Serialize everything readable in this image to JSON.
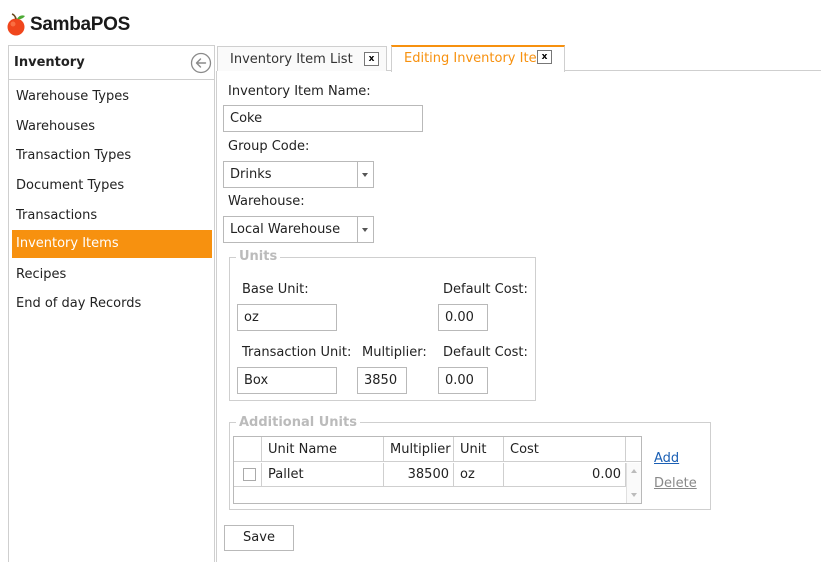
{
  "app": {
    "logo_text": "SambaPOS"
  },
  "sidebar": {
    "title": "Inventory",
    "items": [
      {
        "label": "Warehouse Types",
        "active": false
      },
      {
        "label": "Warehouses",
        "active": false
      },
      {
        "label": "Transaction Types",
        "active": false
      },
      {
        "label": "Document Types",
        "active": false
      },
      {
        "label": "Transactions",
        "active": false
      },
      {
        "label": "Inventory Items",
        "active": true
      },
      {
        "label": "Recipes",
        "active": false
      },
      {
        "label": "End of day Records",
        "active": false
      }
    ]
  },
  "tabs": [
    {
      "label": "Inventory Item List",
      "close": "x",
      "active": false
    },
    {
      "label": "Editing Inventory Item",
      "close": "x",
      "active": true
    }
  ],
  "form": {
    "name_label": "Inventory Item Name:",
    "name_value": "Coke",
    "group_code_label": "Group Code:",
    "group_code_value": "Drinks",
    "warehouse_label": "Warehouse:",
    "warehouse_value": "Local Warehouse",
    "units": {
      "title": "Units",
      "base_unit_label": "Base Unit:",
      "base_unit_value": "oz",
      "default_cost_label": "Default Cost:",
      "base_default_cost_value": "0.00",
      "transaction_unit_label": "Transaction Unit:",
      "transaction_unit_value": "Box",
      "multiplier_label": "Multiplier:",
      "multiplier_value": "3850",
      "transaction_default_cost_value": "0.00"
    },
    "additional_units": {
      "title": "Additional Units",
      "columns": [
        "Unit Name",
        "Multiplier",
        "Unit",
        "Cost"
      ],
      "rows": [
        {
          "checked": false,
          "unit_name": "Pallet",
          "multiplier": "38500",
          "unit": "oz",
          "cost": "0.00"
        }
      ],
      "add_label": "Add",
      "delete_label": "Delete"
    },
    "save_label": "Save"
  },
  "colors": {
    "accent": "#f7910f",
    "link": "#1a5fb4",
    "disabled_text": "#888888"
  },
  "icons": {
    "logo": "orange-fruit-icon",
    "back": "circle-left-arrow-icon",
    "dropdown": "triangle-down-icon"
  }
}
